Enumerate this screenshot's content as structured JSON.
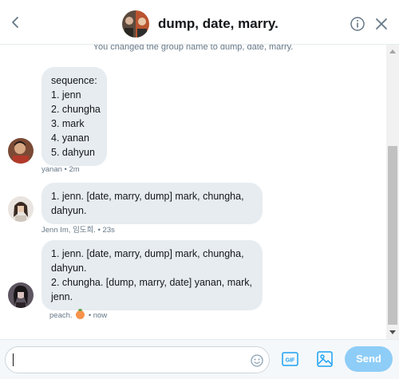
{
  "header": {
    "title": "dump, date, marry.",
    "back_icon": "chevron-left-icon",
    "info_icon": "info-icon",
    "close_icon": "close-icon"
  },
  "conversation": {
    "system_message": "You changed the group name to dump, date, marry.",
    "messages": [
      {
        "sender": "yanan",
        "lines": [
          "sequence:",
          "1. jenn",
          "2. chungha",
          "3. mark",
          "4. yanan",
          "5. dahyun"
        ],
        "meta": "yanan • 2m"
      },
      {
        "sender": "Jenn Im, 임도희.",
        "lines": [
          "1. jenn. [date, marry, dump] mark, chungha,",
          "dahyun."
        ],
        "meta": "Jenn Im, 임도희. • 23s"
      },
      {
        "sender": "peach.",
        "lines": [
          "1. jenn. [date, marry, dump] mark, chungha,",
          "dahyun.",
          "2. chungha. [dump, marry, date] yanan, mark,",
          "jenn."
        ],
        "meta_name": "peach.",
        "meta_emoji": "peach-emoji",
        "meta_time": "• now"
      }
    ]
  },
  "composer": {
    "input_value": "",
    "emoji_icon": "emoji-icon",
    "gif_label": "GIF",
    "image_icon": "image-icon",
    "send_label": "Send"
  },
  "colors": {
    "accent": "#1da1f2",
    "send_disabled": "#8ecdf7",
    "bubble": "#e6ecf0",
    "meta_text": "#657786"
  }
}
